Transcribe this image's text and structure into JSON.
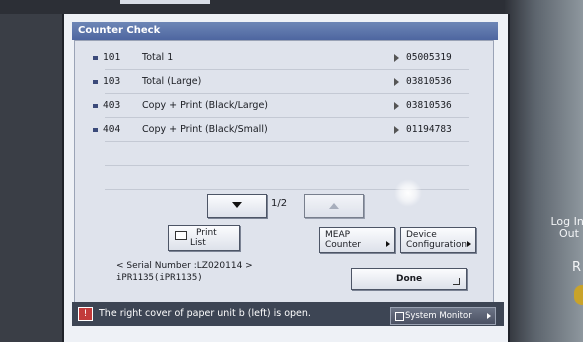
{
  "window": {
    "title": "Counter Check"
  },
  "counters": [
    {
      "num": "101",
      "name": "Total 1",
      "value": "05005319"
    },
    {
      "num": "103",
      "name": "Total (Large)",
      "value": "03810536"
    },
    {
      "num": "403",
      "name": "Copy + Print (Black/Large)",
      "value": "03810536"
    },
    {
      "num": "404",
      "name": "Copy + Print (Black/Small)",
      "value": "01194783"
    }
  ],
  "pagination": {
    "indicator": "1/2"
  },
  "buttons": {
    "print_list_1": "Print",
    "print_list_2": "List",
    "meap_1": "MEAP",
    "meap_2": "Counter",
    "device_1": "Device",
    "device_2": "Configuration",
    "done": "Done",
    "system_monitor": "System Monitor"
  },
  "serial": {
    "label": "< Serial Number :LZ020114 >",
    "model": "iPR1135(iPR1135)"
  },
  "status": {
    "message": "The right cover of paper unit b (left) is open."
  },
  "device_panel": {
    "login_1": "Log In/",
    "login_2": "Out",
    "r_label": "R"
  }
}
